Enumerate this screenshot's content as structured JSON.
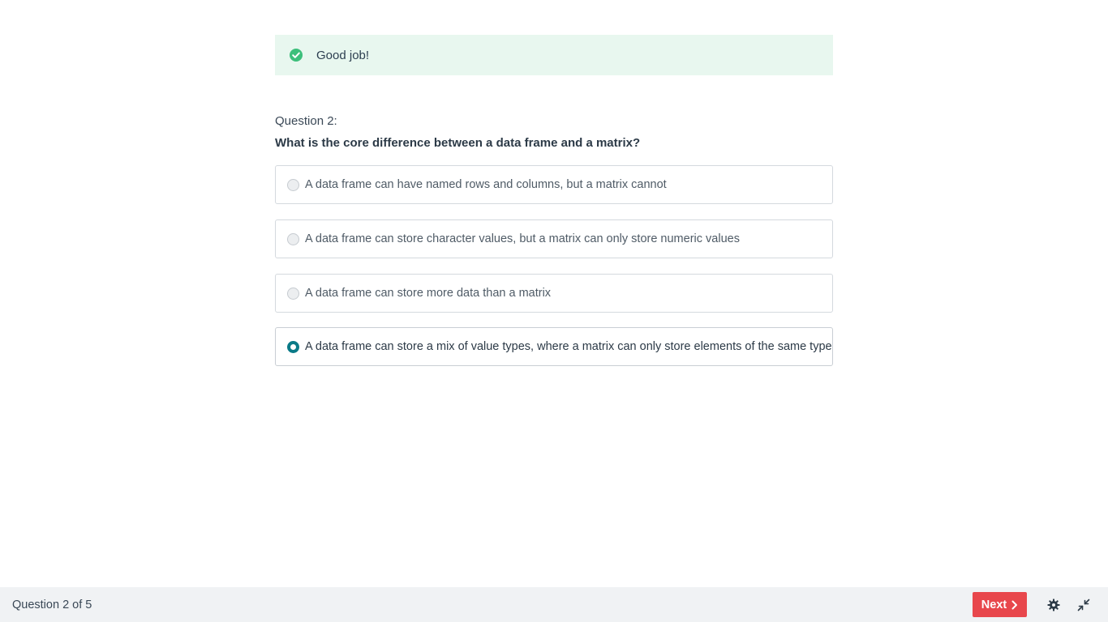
{
  "feedback": {
    "message": "Good job!",
    "icon": "check-circle-icon",
    "color": "#3cbf7b"
  },
  "question": {
    "number_label": "Question 2:",
    "text": "What is the core difference between a data frame and a matrix?",
    "options": [
      {
        "label": "A data frame can have named rows and columns, but a matrix cannot",
        "selected": false
      },
      {
        "label": "A data frame can store character values, but a matrix can only store numeric values",
        "selected": false
      },
      {
        "label": "A data frame can store more data than a matrix",
        "selected": false
      },
      {
        "label": "A data frame can store a mix of value types, where a matrix can only store elements of the same type",
        "selected": true
      }
    ]
  },
  "footer": {
    "progress_label": "Question 2 of 5",
    "next_label": "Next",
    "next_color": "#e8474c",
    "icons": [
      "gear-icon",
      "collapse-icon"
    ]
  },
  "colors": {
    "accent": "#0a7a87",
    "feedback_bg": "#e8f7ef"
  }
}
